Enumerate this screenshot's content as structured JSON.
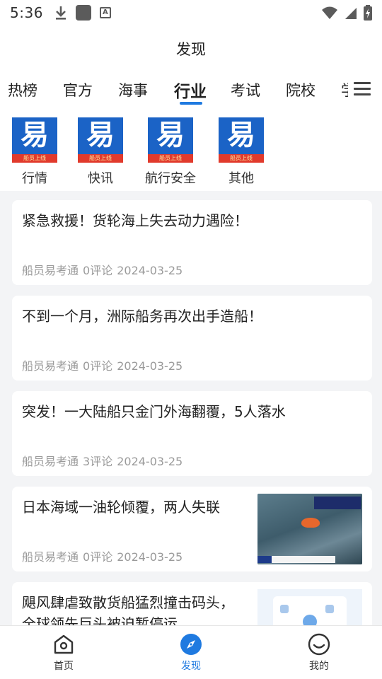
{
  "status_bar": {
    "time": "5:36"
  },
  "header": {
    "title": "发现"
  },
  "tabs": [
    {
      "label": "热榜"
    },
    {
      "label": "官方"
    },
    {
      "label": "海事"
    },
    {
      "label": "行业",
      "active": true
    },
    {
      "label": "考试"
    },
    {
      "label": "院校"
    },
    {
      "label": "学"
    }
  ],
  "categories": [
    {
      "label": "行情",
      "icon": "yi-logo-icon"
    },
    {
      "label": "快讯",
      "icon": "yi-logo-icon"
    },
    {
      "label": "航行安全",
      "icon": "yi-logo-icon"
    },
    {
      "label": "其他",
      "icon": "yi-logo-icon"
    }
  ],
  "logo": {
    "glyph": "易",
    "ribbon_text": "船员上线"
  },
  "articles": [
    {
      "title": "紧急救援！货轮海上失去动力遇险！",
      "source": "船员易考通",
      "comments": "0评论",
      "date": "2024-03-25",
      "has_image": false
    },
    {
      "title": "不到一个月，洲际船务再次出手造船！",
      "source": "船员易考通",
      "comments": "0评论",
      "date": "2024-03-25",
      "has_image": false
    },
    {
      "title": "突发！一大陆船只金门外海翻覆，5人落水",
      "source": "船员易考通",
      "comments": "3评论",
      "date": "2024-03-25",
      "has_image": false
    },
    {
      "title": "日本海域一油轮倾覆，两人失联",
      "source": "船员易考通",
      "comments": "0评论",
      "date": "2024-03-25",
      "has_image": true
    },
    {
      "title": "飓风肆虐致散货船猛烈撞击码头，全球领先巨头被迫暂停运",
      "source": "",
      "comments": "",
      "date": "",
      "has_image": true
    }
  ],
  "bottom_nav": [
    {
      "label": "首页",
      "icon": "home-icon"
    },
    {
      "label": "发现",
      "icon": "compass-icon",
      "active": true
    },
    {
      "label": "我的",
      "icon": "smiley-icon"
    }
  ],
  "colors": {
    "accent": "#1f7ae0",
    "logo_blue": "#1b63c6",
    "logo_red": "#e13a2c",
    "meta_gray": "#9a9a9a",
    "feed_bg": "#f3f4f6"
  }
}
